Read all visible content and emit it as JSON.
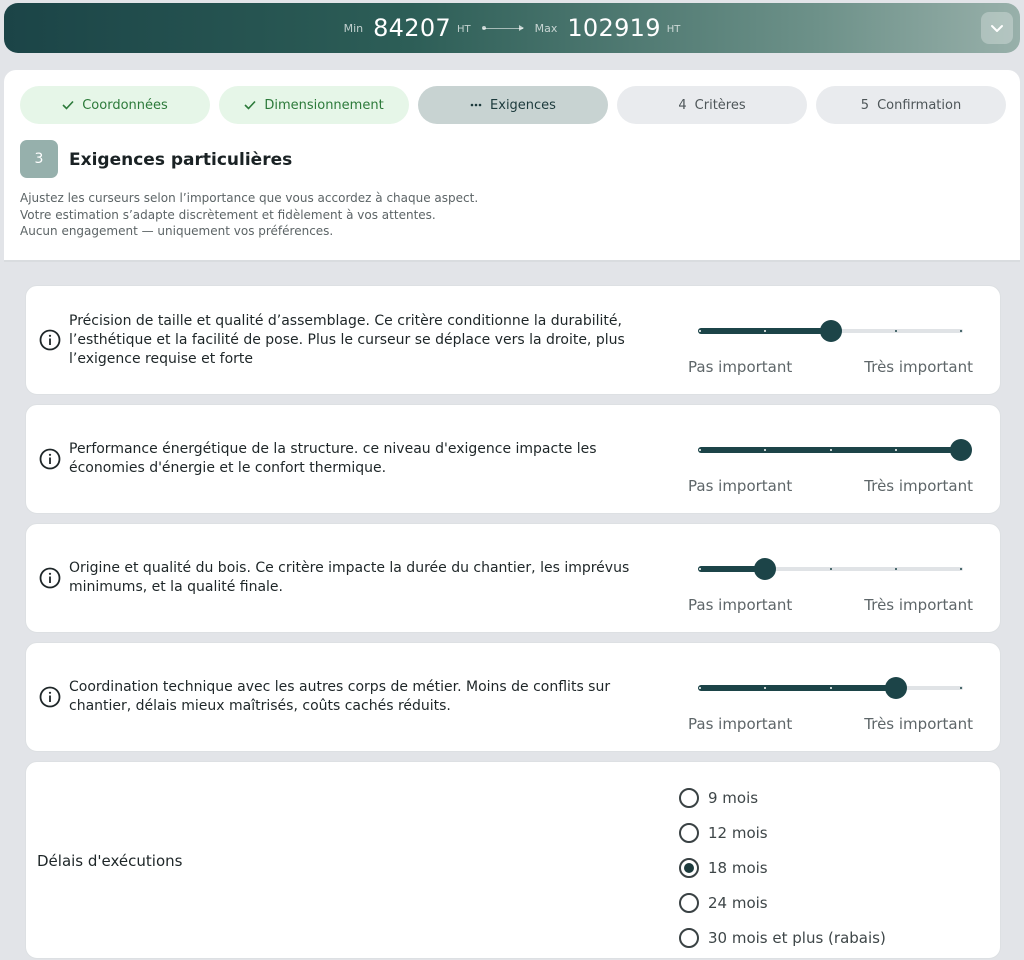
{
  "header": {
    "min_label": "Min",
    "min_value": "84207",
    "max_label": "Max",
    "max_value": "102919",
    "unit": "HT"
  },
  "steps": [
    {
      "label": "Coordonnées",
      "state": "done",
      "icon": "check-icon"
    },
    {
      "label": "Dimensionnement",
      "state": "done",
      "icon": "check-icon"
    },
    {
      "label": "Exigences",
      "state": "active",
      "icon": "dots-icon"
    },
    {
      "label": "Critères",
      "state": "todo",
      "number": "4"
    },
    {
      "label": "Confirmation",
      "state": "todo",
      "number": "5"
    }
  ],
  "section": {
    "number": "3",
    "title": "Exigences particulières",
    "intro": [
      "Ajustez les curseurs selon l’importance que vous accordez à chaque aspect.",
      "Votre estimation s’adapte discrètement et fidèlement à vos attentes.",
      "Aucun engagement — uniquement vos préférences."
    ]
  },
  "criteria": [
    {
      "lines": [
        "Précision de taille et qualité d’assemblage. Ce critère conditionne la durabilité,",
        "l’esthétique et la facilité de pose. Plus le curseur se déplace vers la droite, plus",
        "l’exigence requise et forte"
      ],
      "level": 2,
      "max_level": 4
    },
    {
      "lines": [
        "Performance énergétique de la structure. ce niveau d'exigence impacte les",
        "économies d'énergie et le confort thermique."
      ],
      "level": 4,
      "max_level": 4
    },
    {
      "lines": [
        "Origine et qualité du bois. Ce critère impacte la durée du chantier, les imprévus",
        "minimums, et la qualité finale."
      ],
      "level": 1,
      "max_level": 4
    },
    {
      "lines": [
        "Coordination technique avec les autres corps de métier. Moins de conflits sur",
        "chantier, délais mieux maîtrisés, coûts cachés réduits."
      ],
      "level": 3,
      "max_level": 4
    }
  ],
  "scale": {
    "low": "Pas important",
    "high": "Très important"
  },
  "delays": {
    "label": "Délais d'exécutions",
    "options": [
      "9 mois",
      "12 mois",
      "18 mois",
      "24 mois",
      "30 mois et plus (rabais)"
    ],
    "selected": "18 mois"
  },
  "colors": {
    "accent": "#1c4448",
    "done_bg": "#e6f6e8",
    "done_text": "#2c7a3a"
  }
}
